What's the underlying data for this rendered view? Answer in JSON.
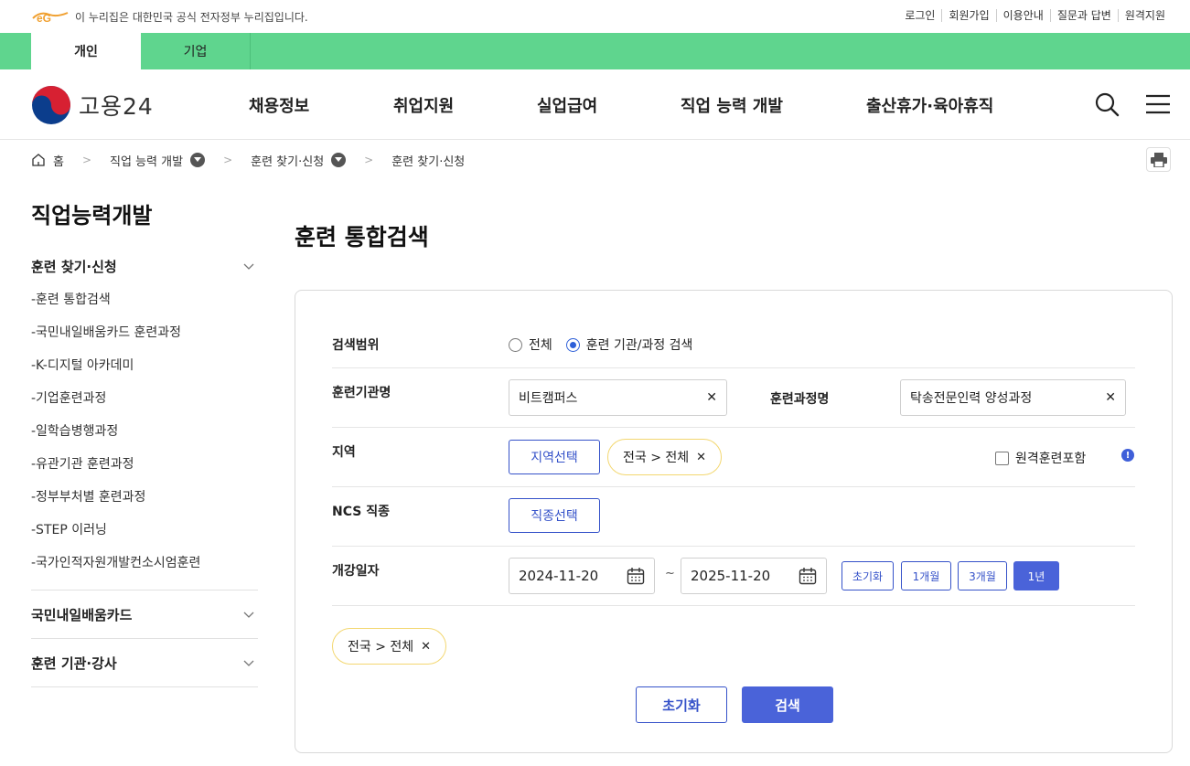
{
  "gov_banner": {
    "text": "이 누리집은 대한민국 공식 전자정부 누리집입니다.",
    "links": [
      "로그인",
      "회원가입",
      "이용안내",
      "질문과 답변",
      "원격지원"
    ]
  },
  "user_type": {
    "personal": "개인",
    "business": "기업"
  },
  "header": {
    "logo_text": "고용24",
    "menu": [
      "채용정보",
      "취업지원",
      "실업급여",
      "직업 능력 개발",
      "출산휴가·육아휴직"
    ]
  },
  "breadcrumb": {
    "home": "홈",
    "level1": "직업 능력 개발",
    "level2": "훈련 찾기·신청",
    "current": "훈련 찾기·신청"
  },
  "lnb": {
    "title": "직업능력개발",
    "group1": "훈련 찾기·신청",
    "items": [
      "-훈련 통합검색",
      "-국민내일배움카드 훈련과정",
      "-K-디지털 아카데미",
      "-기업훈련과정",
      "-일학습병행과정",
      "-유관기관 훈련과정",
      "-정부부처별 훈련과정",
      "-STEP 이러닝",
      "-국가인적자원개발컨소시엄훈련"
    ],
    "group2": "국민내일배움카드",
    "group3": "훈련 기관·강사"
  },
  "search": {
    "page_title": "훈련 통합검색",
    "scope_label": "검색범위",
    "scope_all": "전체",
    "scope_institution": "훈련 기관/과정 검색",
    "institution_label": "훈련기관명",
    "institution_value": "비트캠퍼스",
    "course_label": "훈련과정명",
    "course_value": "탁송전문인력 양성과정",
    "region_label": "지역",
    "region_button": "지역선택",
    "region_chip": "전국 > 전체",
    "remote_label": "원격훈련포함",
    "ncs_label": "NCS 직종",
    "ncs_button": "직종선택",
    "date_label": "개강일자",
    "date_from": "2024-11-20",
    "date_to": "2025-11-20",
    "date_sep": "~",
    "period_buttons": [
      "초기화",
      "1개월",
      "3개월",
      "1년"
    ],
    "selected_chip": "전국 > 전체",
    "reset_button": "초기화",
    "search_button": "검색"
  }
}
